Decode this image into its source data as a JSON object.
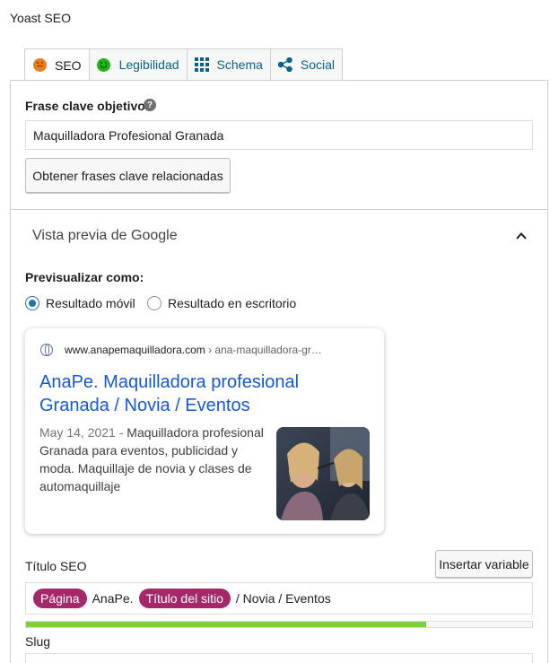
{
  "panel": {
    "title": "Yoast SEO"
  },
  "tabs": [
    {
      "label": "SEO",
      "icon": "orange-face-icon"
    },
    {
      "label": "Legibilidad",
      "icon": "green-face-icon"
    },
    {
      "label": "Schema",
      "icon": "grid-icon"
    },
    {
      "label": "Social",
      "icon": "share-icon"
    }
  ],
  "focus_keyphrase": {
    "label": "Frase clave objetivo",
    "help": "?",
    "value": "Maquilladora Profesional Granada",
    "related_button": "Obtener frases clave relacionadas"
  },
  "google_preview": {
    "heading": "Vista previa de Google",
    "preview_as_label": "Previsualizar como:",
    "options": [
      "Resultado móvil",
      "Resultado en escritorio"
    ],
    "selected": "Resultado móvil",
    "url_domain": "www.anapemaquilladora.com",
    "url_crumb": " › ana-maquilladora-gr…",
    "title": "AnaPe. Maquilladora profesional Granada / Novia / Eventos",
    "date": "May 14, 2021",
    "separator": " - ",
    "description": "Maquilladora profesional Granada para eventos, publicidad y moda. Maquillaje de novia y clases de automaquillaje"
  },
  "seo_title": {
    "label": "Título SEO",
    "insert_button": "Insertar variable",
    "parts": {
      "pill1": "Página",
      "text1": "AnaPe.",
      "pill2": "Título del sitio",
      "text2": "/ Novia / Eventos"
    },
    "progress_fraction": 0.79
  },
  "slug": {
    "label": "Slug"
  },
  "colors": {
    "pill": "#a4286a",
    "progress": "#7ad03a",
    "link": "#1558d6",
    "radio": "#2271b1"
  }
}
